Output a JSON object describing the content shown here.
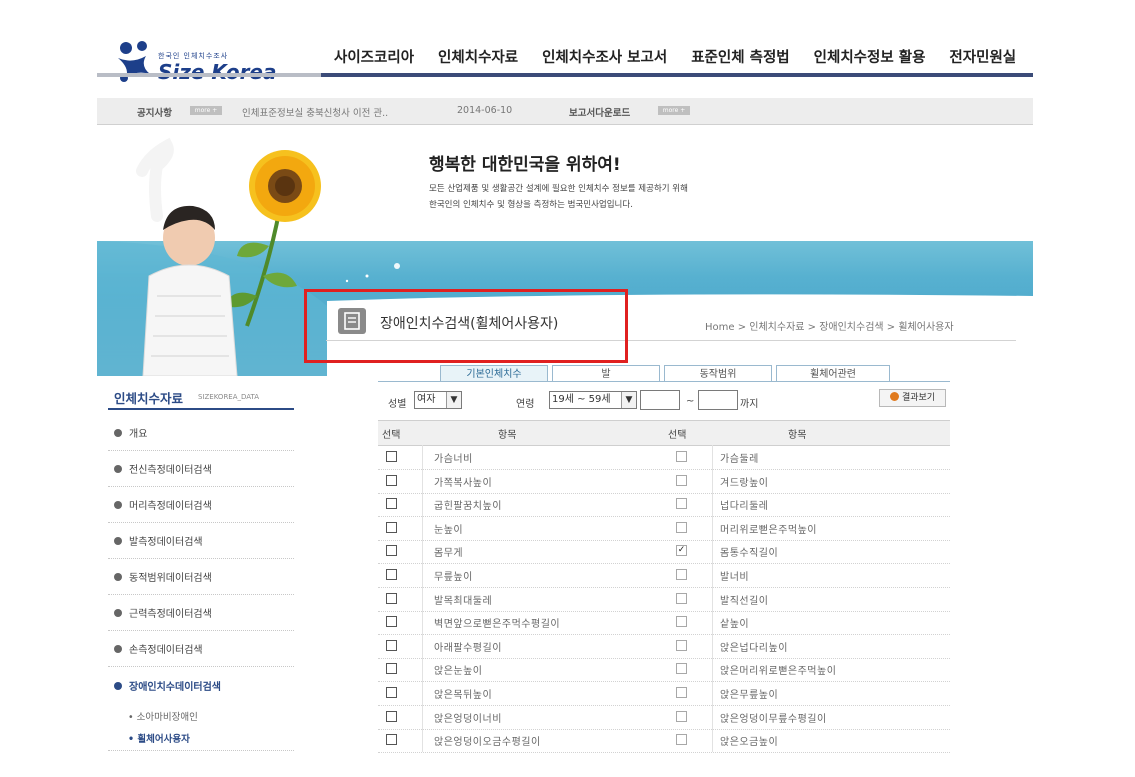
{
  "logo": {
    "small": "한국인 인체치수조사",
    "big": "Size Korea"
  },
  "nav": [
    "사이즈코리아",
    "인체치수자료",
    "인체치수조사 보고서",
    "표준인체 측정법",
    "인체치수정보 활용",
    "전자민원실"
  ],
  "notice": {
    "label": "공지사항",
    "more": "more +",
    "headline": "인체표준정보실 충북신청사 이전 관..",
    "date": "2014-06-10",
    "report_label": "보고서다운로드",
    "report_more": "more +"
  },
  "hero": {
    "title": "행복한 대한민국을 위하여!",
    "line1": "모든 산업제품 및 생활공간 설계에 필요한 인체치수 정보를 제공하기 위해",
    "line2": "한국인의 인체치수 및 형상을 측정하는 범국민사업입니다."
  },
  "page": {
    "title": "장애인치수검색(휠체어사용자)",
    "breadcrumb": "Home > 인체치수자료 > 장애인치수검색 > 휠체어사용자"
  },
  "sidebar": {
    "title": "인체치수자료",
    "subtitle": "SIZEKOREA_DATA",
    "items": [
      "개요",
      "전신측정데이터검색",
      "머리측정데이터검색",
      "발측정데이터검색",
      "동적범위데이터검색",
      "근력측정데이터검색",
      "손측정데이터검색",
      "장애인치수데이터검색"
    ],
    "subitems": [
      "소아마비장애인",
      "휠체어사용자"
    ]
  },
  "tabs": [
    "기본인체치수",
    "발",
    "동작범위",
    "휠체어관련"
  ],
  "filters": {
    "gender_label": "성별",
    "gender_value": "여자",
    "age_label": "연령",
    "age_value": "19세 ~ 59세",
    "range_sep": "~",
    "range_to": "까지",
    "result_button": "결과보기"
  },
  "table": {
    "headers": {
      "select": "선택",
      "item": "항목"
    },
    "rows": [
      {
        "left": "가슴너비",
        "right": "가슴둘레",
        "right_checked": false
      },
      {
        "left": "가쪽복사높이",
        "right": "겨드랑높이",
        "right_checked": false
      },
      {
        "left": "굽힌팔꿈치높이",
        "right": "넙다리둘레",
        "right_checked": false
      },
      {
        "left": "눈높이",
        "right": "머리위로뻗은주먹높이",
        "right_checked": false
      },
      {
        "left": "몸무게",
        "right": "몸통수직길이",
        "right_checked": true
      },
      {
        "left": "무릎높이",
        "right": "발너비",
        "right_checked": false
      },
      {
        "left": "발목최대둘레",
        "right": "발직선길이",
        "right_checked": false
      },
      {
        "left": "벽면앞으로뻗은주먹수평길이",
        "right": "샅높이",
        "right_checked": false
      },
      {
        "left": "아래팔수평길이",
        "right": "앉은넙다리높이",
        "right_checked": false
      },
      {
        "left": "앉은눈높이",
        "right": "앉은머리위로뻗은주먹높이",
        "right_checked": false
      },
      {
        "left": "앉은목뒤높이",
        "right": "앉은무릎높이",
        "right_checked": false
      },
      {
        "left": "앉은엉덩이너비",
        "right": "앉은엉덩이무릎수평길이",
        "right_checked": false
      },
      {
        "left": "앉은엉덩이오금수평길이",
        "right": "앉은오금높이",
        "right_checked": false
      }
    ]
  },
  "colors": {
    "brand_blue": "#2c4b86",
    "highlight_red": "#e02020",
    "sky": "#4aa9cc"
  }
}
